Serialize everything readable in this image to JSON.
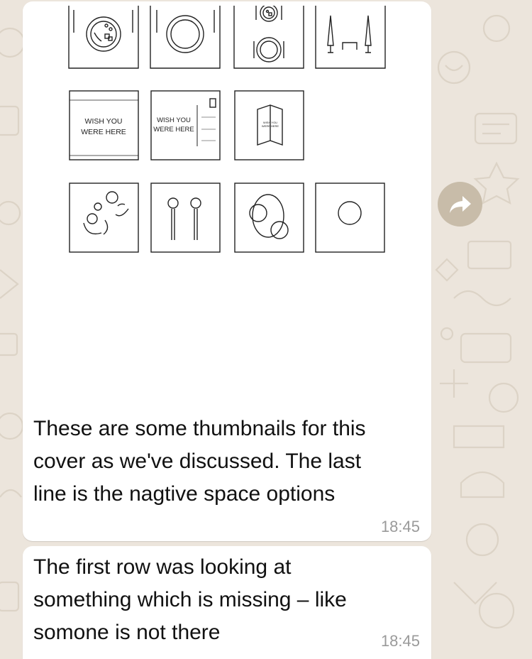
{
  "colors": {
    "wallpaper": "#ece5dc",
    "bubble": "#ffffff",
    "forward_button": "#c8bca9",
    "timestamp": "#9a9a9a"
  },
  "messages": [
    {
      "text": "These are some thumbnails for this\ncover as we've discussed. The last\nline is the nagtive space options",
      "time": "18:45",
      "has_image": true
    },
    {
      "text": "The first row was looking at\nsomething which is missing – like\nsomone is not there",
      "time": "18:45",
      "has_image": false
    }
  ],
  "thumbnails": {
    "postcard_text_line1": "WISH YOU",
    "postcard_text_line2": "WERE HERE"
  },
  "icons": {
    "forward": "forward-arrow-icon"
  }
}
